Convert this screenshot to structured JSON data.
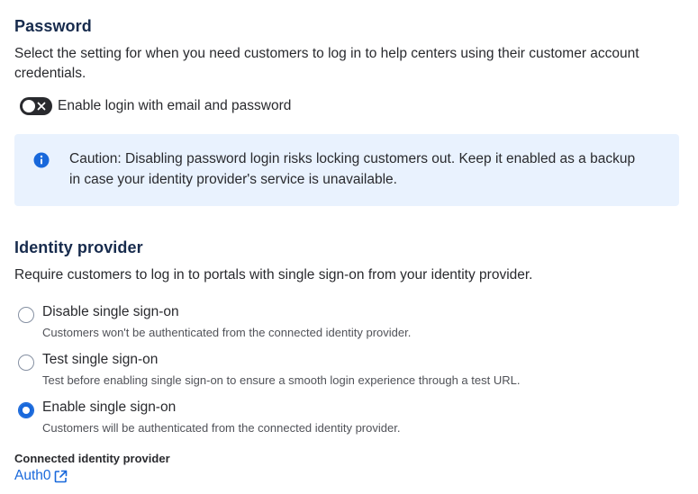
{
  "password": {
    "title": "Password",
    "description": "Select the setting for when you need customers to log in to help centers using their customer account credentials.",
    "toggle_label": "Enable login with email and password",
    "toggle_on": false,
    "caution": "Caution: Disabling password login risks locking customers out. Keep it enabled as a backup in case your identity provider's service is unavailable."
  },
  "identity_provider": {
    "title": "Identity provider",
    "description": "Require customers to log in to portals with single sign-on from your identity provider.",
    "options": [
      {
        "label": "Disable single sign-on",
        "helper": "Customers won't be authenticated from the connected identity provider.",
        "selected": false
      },
      {
        "label": "Test single sign-on",
        "helper": "Test before enabling single sign-on to ensure a smooth login experience through a test URL.",
        "selected": false
      },
      {
        "label": "Enable single sign-on",
        "helper": "Customers will be authenticated from the connected identity provider.",
        "selected": true
      }
    ],
    "connected_label": "Connected identity provider",
    "connected_provider": "Auth0"
  },
  "colors": {
    "accent": "#1868db",
    "info_background": "#e9f2fe",
    "toggle_off": "#292a2e"
  }
}
